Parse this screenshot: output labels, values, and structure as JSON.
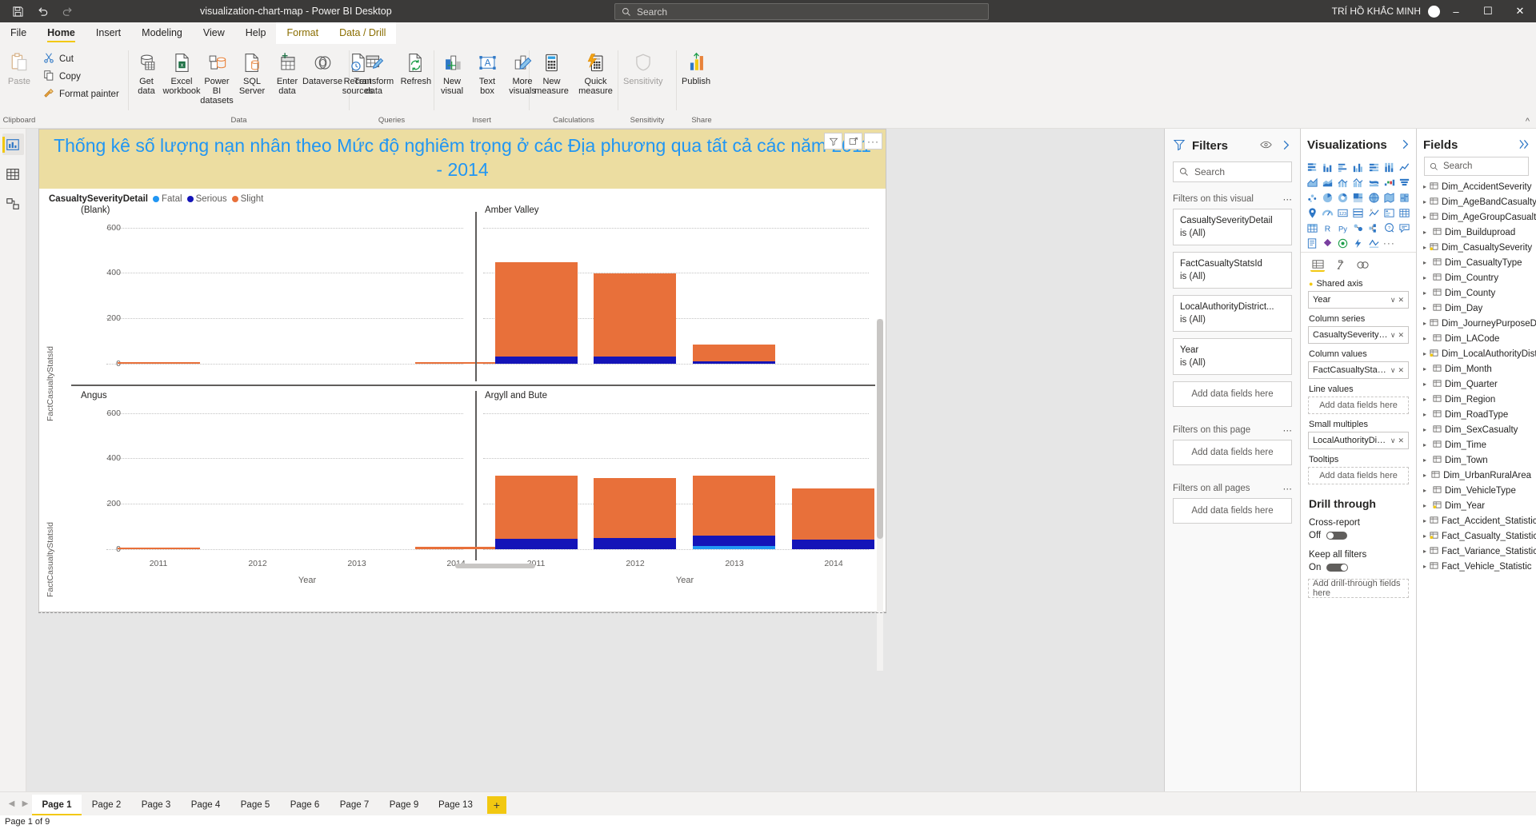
{
  "titlebar": {
    "app_title": "visualization-chart-map - Power BI Desktop",
    "save_icon": "save-icon",
    "undo_icon": "undo-icon",
    "redo_icon": "redo-icon",
    "search_placeholder": "Search",
    "user_name": "TRÍ HỒ KHẮC MINH",
    "minimize": "–",
    "maximize": "☐",
    "close": "✕"
  },
  "menu": {
    "tabs": [
      {
        "label": "File",
        "state": "normal"
      },
      {
        "label": "Home",
        "state": "active"
      },
      {
        "label": "Insert",
        "state": "normal"
      },
      {
        "label": "Modeling",
        "state": "normal"
      },
      {
        "label": "View",
        "state": "normal"
      },
      {
        "label": "Help",
        "state": "normal"
      },
      {
        "label": "Format",
        "state": "contextual"
      },
      {
        "label": "Data / Drill",
        "state": "contextual"
      }
    ]
  },
  "ribbon": {
    "groups": [
      {
        "label": "Clipboard",
        "big": [
          {
            "label": "Paste",
            "icon": "paste-icon",
            "disabled": true
          }
        ],
        "small": [
          {
            "label": "Cut",
            "icon": "cut-icon"
          },
          {
            "label": "Copy",
            "icon": "copy-icon"
          },
          {
            "label": "Format painter",
            "icon": "format-painter-icon"
          }
        ]
      },
      {
        "label": "Data",
        "big": [
          {
            "label": "Get data",
            "icon": "get-data-icon",
            "caret": true
          },
          {
            "label": "Excel workbook",
            "icon": "excel-icon"
          },
          {
            "label": "Power BI datasets",
            "icon": "powerbi-datasets-icon"
          },
          {
            "label": "SQL Server",
            "icon": "sql-server-icon"
          },
          {
            "label": "Enter data",
            "icon": "enter-data-icon"
          },
          {
            "label": "Dataverse",
            "icon": "dataverse-icon"
          },
          {
            "label": "Recent sources",
            "icon": "recent-sources-icon",
            "caret": true
          }
        ]
      },
      {
        "label": "Queries",
        "big": [
          {
            "label": "Transform data",
            "icon": "transform-data-icon",
            "caret": true
          },
          {
            "label": "Refresh",
            "icon": "refresh-icon"
          }
        ]
      },
      {
        "label": "Insert",
        "big": [
          {
            "label": "New visual",
            "icon": "new-visual-icon"
          },
          {
            "label": "Text box",
            "icon": "text-box-icon"
          },
          {
            "label": "More visuals",
            "icon": "more-visuals-icon",
            "caret": true
          }
        ]
      },
      {
        "label": "Calculations",
        "big": [
          {
            "label": "New measure",
            "icon": "new-measure-icon"
          },
          {
            "label": "Quick measure",
            "icon": "quick-measure-icon"
          }
        ]
      },
      {
        "label": "Sensitivity",
        "big": [
          {
            "label": "Sensitivity",
            "icon": "sensitivity-icon",
            "caret": true,
            "disabled": true
          }
        ]
      },
      {
        "label": "Share",
        "big": [
          {
            "label": "Publish",
            "icon": "publish-icon"
          }
        ]
      }
    ],
    "collapse_icon": "collapse-ribbon-icon"
  },
  "left_rail": {
    "items": [
      {
        "name": "report-view",
        "icon": "report-view-icon",
        "selected": true
      },
      {
        "name": "data-view",
        "icon": "data-view-icon",
        "selected": false
      },
      {
        "name": "model-view",
        "icon": "model-view-icon",
        "selected": false
      }
    ]
  },
  "visual": {
    "title": "Thống kê số lượng nạn nhân theo Mức độ nghiêm trọng ở các Địa phương qua tất cả các năm 2011 - 2014",
    "title_color": "#2196f3",
    "title_bg": "#ecdda1",
    "header_tools": [
      "filter-icon",
      "focus-mode-icon",
      "more-options-icon"
    ]
  },
  "chart_data": {
    "type": "bar",
    "stacked": true,
    "small_multiples": true,
    "title": "Thống kê số lượng nạn nhân theo Mức độ nghiêm trọng ở các Địa phương qua tất cả các năm 2011 - 2014",
    "legend_title": "CasualtySeverityDetail",
    "legend_position": "top",
    "legend": [
      {
        "name": "Fatal",
        "color": "#2196f3"
      },
      {
        "name": "Serious",
        "color": "#1414b8"
      },
      {
        "name": "Slight",
        "color": "#e8703a"
      }
    ],
    "xlabel": "Year",
    "ylabel": "FactCasualtyStatsId",
    "categories": [
      "2011",
      "2012",
      "2013",
      "2014"
    ],
    "ylim": [
      0,
      700
    ],
    "yticks": [
      0,
      200,
      400,
      600
    ],
    "grid": true,
    "panels": [
      {
        "name": "(Blank)",
        "series": [
          {
            "name": "Fatal",
            "values": [
              0,
              0,
              0,
              0
            ]
          },
          {
            "name": "Serious",
            "values": [
              0,
              0,
              0,
              0
            ]
          },
          {
            "name": "Slight",
            "values": [
              4,
              0,
              0,
              3
            ]
          }
        ]
      },
      {
        "name": "Amber Valley",
        "series": [
          {
            "name": "Fatal",
            "values": [
              5,
              5,
              4,
              0
            ]
          },
          {
            "name": "Serious",
            "values": [
              30,
              30,
              5,
              0
            ]
          },
          {
            "name": "Slight",
            "values": [
              385,
              340,
              60,
              0
            ]
          }
        ]
      },
      {
        "name": "Angus",
        "series": [
          {
            "name": "Fatal",
            "values": [
              0,
              0,
              0,
              0
            ]
          },
          {
            "name": "Serious",
            "values": [
              0,
              0,
              0,
              0
            ]
          },
          {
            "name": "Slight",
            "values": [
              4,
              0,
              0,
              3
            ]
          }
        ]
      },
      {
        "name": "Argyll and Bute",
        "series": [
          {
            "name": "Fatal",
            "values": [
              5,
              5,
              10,
              5
            ]
          },
          {
            "name": "Serious",
            "values": [
              40,
              45,
              45,
              40
            ]
          },
          {
            "name": "Slight",
            "values": [
              275,
              260,
              270,
              220
            ]
          }
        ]
      }
    ]
  },
  "filters_pane": {
    "title": "Filters",
    "filter_icon": "filter-funnel-icon",
    "hide_icon": "eye-icon",
    "expand_icon": "chevron-right-icon",
    "search_placeholder": "Search",
    "search_icon": "search-icon",
    "sections": [
      {
        "label": "Filters on this visual",
        "more": "⋯",
        "cards": [
          {
            "field": "CasualtySeverityDetail",
            "value": "is (All)"
          },
          {
            "field": "FactCasualtyStatsId",
            "value": "is (All)"
          },
          {
            "field": "LocalAuthorityDistrict...",
            "value": "is (All)"
          },
          {
            "field": "Year",
            "value": "is (All)"
          }
        ],
        "add_label": "Add data fields here"
      },
      {
        "label": "Filters on this page",
        "more": "⋯",
        "cards": [],
        "add_label": "Add data fields here"
      },
      {
        "label": "Filters on all pages",
        "more": "⋯",
        "cards": [],
        "add_label": "Add data fields here"
      }
    ]
  },
  "viz_pane": {
    "title": "Visualizations",
    "expand_icon": "chevron-right-icon",
    "gallery_rows": [
      [
        "stacked-bar-chart-icon",
        "stacked-column-chart-icon",
        "clustered-bar-chart-icon",
        "clustered-column-chart-icon",
        "100-stacked-bar-chart-icon",
        "100-stacked-column-chart-icon",
        "line-chart-icon"
      ],
      [
        "area-chart-icon",
        "stacked-area-chart-icon",
        "line-stacked-column-icon",
        "line-clustered-column-icon",
        "ribbon-chart-icon",
        "waterfall-chart-icon",
        "funnel-chart-icon"
      ],
      [
        "scatter-chart-icon",
        "pie-chart-icon",
        "donut-chart-icon",
        "treemap-icon",
        "map-icon",
        "filled-map-icon",
        "shape-map-icon"
      ],
      [
        "azure-map-icon",
        "gauge-icon",
        "card-icon",
        "multi-row-card-icon",
        "kpi-icon",
        "slicer-icon",
        "table-icon"
      ],
      [
        "matrix-icon",
        "r-script-visual-icon",
        "py-visual-icon",
        "key-influencers-icon",
        "decomposition-tree-icon",
        "q-and-a-icon",
        "smart-narrative-icon"
      ],
      [
        "paginated-report-icon",
        "power-apps-icon",
        "arcgis-maps-icon",
        "power-automate-icon",
        "get-more-visuals-icon",
        "more-options-icon"
      ]
    ],
    "tabs": [
      "fields-tab-icon",
      "format-tab-icon",
      "analytics-tab-icon"
    ],
    "wells": [
      {
        "label": "Shared axis",
        "bullet": true,
        "items": [
          {
            "value": "Year",
            "caret": "∨",
            "remove": "✕"
          }
        ]
      },
      {
        "label": "Column series",
        "bullet": false,
        "items": [
          {
            "value": "CasualtySeverityDetail",
            "caret": "∨",
            "remove": "✕"
          }
        ]
      },
      {
        "label": "Column values",
        "bullet": false,
        "items": [
          {
            "value": "FactCasualtyStatsId",
            "caret": "∨",
            "remove": "✕"
          }
        ]
      },
      {
        "label": "Line values",
        "bullet": false,
        "items": [],
        "placeholder": "Add data fields here"
      },
      {
        "label": "Small multiples",
        "bullet": false,
        "items": [
          {
            "value": "LocalAuthorityDistrict...",
            "caret": "∨",
            "remove": "✕"
          }
        ]
      },
      {
        "label": "Tooltips",
        "bullet": false,
        "items": [],
        "placeholder": "Add data fields here"
      }
    ],
    "drill_through": {
      "heading": "Drill through",
      "cross_report_label": "Cross-report",
      "cross_report_state": "Off",
      "keep_filters_label": "Keep all filters",
      "keep_filters_state": "On",
      "add_label": "Add drill-through fields here"
    }
  },
  "fields_pane": {
    "title": "Fields",
    "expand_icon": "chevrons-right-icon",
    "search_placeholder": "Search",
    "search_icon": "search-icon",
    "tables": [
      {
        "name": "Dim_AccidentSeverity",
        "icon": "table-icon"
      },
      {
        "name": "Dim_AgeBandCasualty",
        "icon": "table-icon"
      },
      {
        "name": "Dim_AgeGroupCasualty",
        "icon": "table-icon"
      },
      {
        "name": "Dim_Builduproad",
        "icon": "table-icon"
      },
      {
        "name": "Dim_CasualtySeverity",
        "icon": "table-key-icon"
      },
      {
        "name": "Dim_CasualtyType",
        "icon": "table-icon"
      },
      {
        "name": "Dim_Country",
        "icon": "table-icon"
      },
      {
        "name": "Dim_County",
        "icon": "table-icon"
      },
      {
        "name": "Dim_Day",
        "icon": "table-icon"
      },
      {
        "name": "Dim_JourneyPurposeDr...",
        "icon": "table-icon"
      },
      {
        "name": "Dim_LACode",
        "icon": "table-icon"
      },
      {
        "name": "Dim_LocalAuthorityDist...",
        "icon": "table-key-icon"
      },
      {
        "name": "Dim_Month",
        "icon": "table-icon"
      },
      {
        "name": "Dim_Quarter",
        "icon": "table-icon"
      },
      {
        "name": "Dim_Region",
        "icon": "table-icon"
      },
      {
        "name": "Dim_RoadType",
        "icon": "table-icon"
      },
      {
        "name": "Dim_SexCasualty",
        "icon": "table-icon"
      },
      {
        "name": "Dim_Time",
        "icon": "table-icon"
      },
      {
        "name": "Dim_Town",
        "icon": "table-icon"
      },
      {
        "name": "Dim_UrbanRuralArea",
        "icon": "table-icon"
      },
      {
        "name": "Dim_VehicleType",
        "icon": "table-icon"
      },
      {
        "name": "Dim_Year",
        "icon": "table-key-icon"
      },
      {
        "name": "Fact_Accident_Statistic",
        "icon": "table-icon"
      },
      {
        "name": "Fact_Casualty_Statistic",
        "icon": "table-key-icon"
      },
      {
        "name": "Fact_Variance_Statistic",
        "icon": "table-icon"
      },
      {
        "name": "Fact_Vehicle_Statistic",
        "icon": "table-icon"
      }
    ]
  },
  "page_tabs": {
    "prev_icon": "chevron-left-icon",
    "next_icon": "chevron-right-icon",
    "tabs": [
      {
        "label": "Page 1",
        "active": true
      },
      {
        "label": "Page 2",
        "active": false
      },
      {
        "label": "Page 3",
        "active": false
      },
      {
        "label": "Page 4",
        "active": false
      },
      {
        "label": "Page 5",
        "active": false
      },
      {
        "label": "Page 6",
        "active": false
      },
      {
        "label": "Page 7",
        "active": false
      },
      {
        "label": "Page 9",
        "active": false
      },
      {
        "label": "Page 13",
        "active": false
      }
    ],
    "add_label": "+"
  },
  "status_bar": {
    "text": "Page 1 of 9"
  }
}
